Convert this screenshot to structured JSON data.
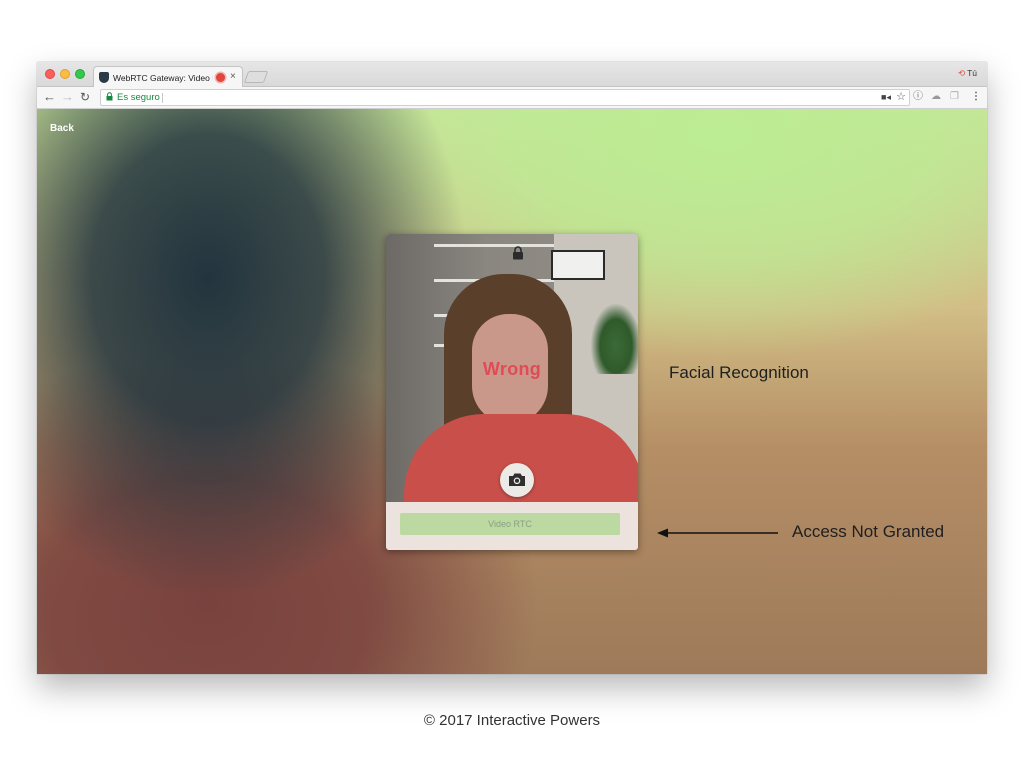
{
  "browser": {
    "tab_title": "WebRTC Gateway: Video R",
    "tab_close": "×",
    "profile_name": "Tú",
    "address_secure_text": "Es seguro"
  },
  "page": {
    "back_label": "Back",
    "status_text": "Wrong",
    "button_label": "Video RTC"
  },
  "annotations": {
    "facial_recognition": "Facial Recognition",
    "access_not_granted": "Access Not Granted"
  },
  "footer": {
    "copyright": "© 2017 Interactive Powers"
  },
  "colors": {
    "status_wrong": "#e04b55",
    "button_disabled_bg": "#bcd9a1",
    "secure_green": "#178a3f"
  }
}
